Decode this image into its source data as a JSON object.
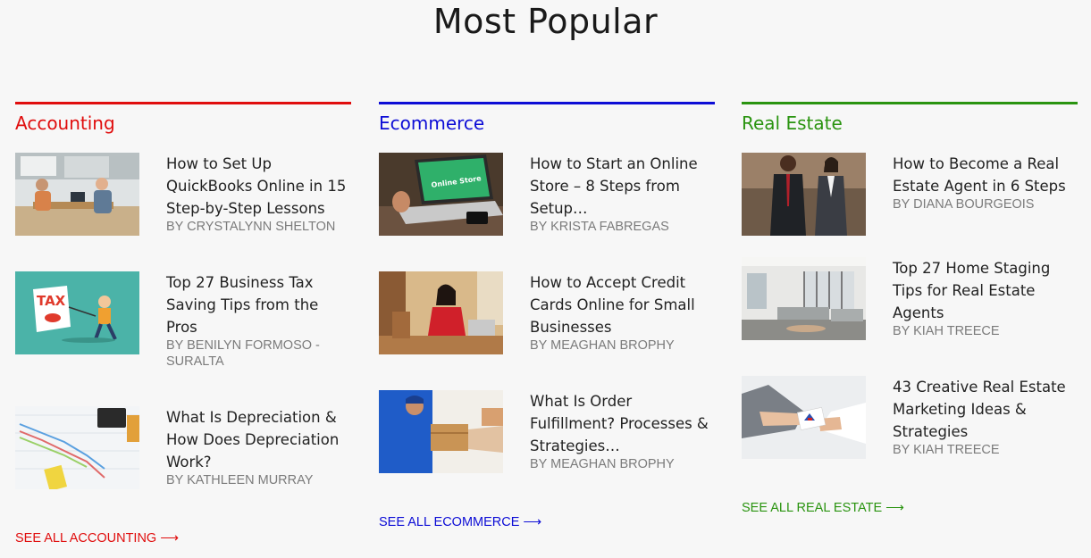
{
  "page": {
    "title": "Most Popular"
  },
  "colors": {
    "accounting": "#e00d0d",
    "ecommerce": "#0d0dd6",
    "real_estate": "#2a9410"
  },
  "columns": [
    {
      "title": "Accounting",
      "see_all": "SEE ALL ACCOUNTING ⟶",
      "articles": [
        {
          "title": "How to Set Up QuickBooks Online in 15 Step-by-Step Lessons",
          "author": "BY CRYSTALYNN SHELTON",
          "image": "office-meeting-photo"
        },
        {
          "title": "Top 27 Business Tax Saving Tips from the Pros",
          "author": "BY BENILYN FORMOSO - SURALTA",
          "image": "tax-cartoon-illustration"
        },
        {
          "title": "What Is Depreciation & How Does Depreciation Work?",
          "author": "BY KATHLEEN MURRAY",
          "image": "chart-calculator-photo"
        }
      ]
    },
    {
      "title": "Ecommerce",
      "see_all": "SEE ALL ECOMMERCE ⟶",
      "articles": [
        {
          "title": "How to Start an Online Store – 8 Steps from Setup…",
          "author": "BY KRISTA FABREGAS",
          "image": "laptop-online-store-photo"
        },
        {
          "title": "How to Accept Credit Cards Online for Small Businesses",
          "author": "BY MEAGHAN BROPHY",
          "image": "woman-credit-card-photo"
        },
        {
          "title": "What Is Order Fulfillment? Processes & Strategies…",
          "author": "BY MEAGHAN BROPHY",
          "image": "package-delivery-photo"
        }
      ]
    },
    {
      "title": "Real Estate",
      "see_all": "SEE ALL REAL ESTATE ⟶",
      "articles": [
        {
          "title": "How to Become a Real Estate Agent in 6 Steps",
          "author": "BY DIANA BOURGEOIS",
          "image": "agents-walking-photo"
        },
        {
          "title": "Top 27 Home Staging Tips for Real Estate Agents",
          "author": "BY KIAH TREECE",
          "image": "living-room-photo"
        },
        {
          "title": "43 Creative Real Estate Marketing Ideas & Strategies",
          "author": "BY KIAH TREECE",
          "image": "business-card-photo"
        }
      ]
    }
  ]
}
